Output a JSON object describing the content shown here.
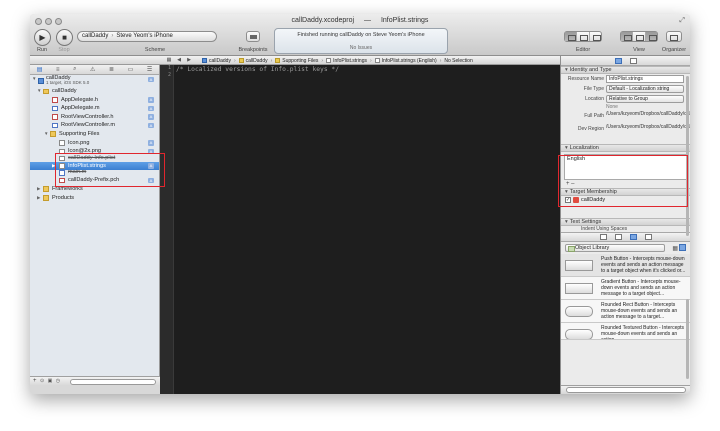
{
  "window": {
    "project": "callDaddy.xcodeproj",
    "separator": "—",
    "file": "InfoPlist.strings"
  },
  "toolbar": {
    "run_label": "Run",
    "stop_label": "Stop",
    "scheme_label": "Scheme",
    "breakpoints_label": "Breakpoints",
    "editor_label": "Editor",
    "view_label": "View",
    "organizer_label": "Organizer",
    "scheme_target": "callDaddy",
    "scheme_device": "Steve Yeom's iPhone",
    "activity_status": "Finished running callDaddy on Steve Yeom's iPhone",
    "activity_issues": "No Issues"
  },
  "jumpbar": {
    "crumbs": [
      "callDaddy",
      "callDaddy",
      "Supporting Files",
      "InfoPlist.strings",
      "InfoPlist.strings (English)",
      "No Selection"
    ]
  },
  "navigator": {
    "project_name": "callDaddy",
    "project_sub": "1 target, iOS SDK 5.0",
    "items": [
      {
        "label": "callDaddy"
      },
      {
        "label": "AppDelegate.h"
      },
      {
        "label": "AppDelegate.m"
      },
      {
        "label": "RootViewController.h"
      },
      {
        "label": "RootViewController.m"
      },
      {
        "label": "Supporting Files"
      },
      {
        "label": "Icon.png"
      },
      {
        "label": "Icon@2x.png"
      },
      {
        "label": "callDaddy-Info.plist"
      },
      {
        "label": "InfoPlist.strings"
      },
      {
        "label": "main.m"
      },
      {
        "label": "callDaddy-Prefix.pch"
      },
      {
        "label": "Frameworks"
      },
      {
        "label": "Products"
      }
    ],
    "badge": "A"
  },
  "editor": {
    "lines": [
      "1",
      "2"
    ],
    "code": "/* Localized versions of Info.plist keys */"
  },
  "inspector": {
    "identity_header": "Identity and Type",
    "resource_name_label": "Resource Name",
    "resource_name": "InfoPlist.strings",
    "file_type_label": "File Type",
    "file_type": "Default - Localization string",
    "location_label": "Location",
    "location": "Relative to Group",
    "location_none": "None",
    "full_path_label": "Full Path",
    "full_path": "/Users/kzyeom/Dropbox/callDaddy/callDaddy",
    "dev_region_label": "Dev Region",
    "dev_region": "/Users/kzyeom/Dropbox/callDaddy/callDaddy/en.lproj/InfoPlist.strings",
    "localization_header": "Localization",
    "localization_value": "English",
    "loc_controls": "+  –",
    "target_header": "Target Membership",
    "target_name": "callDaddy",
    "text_header": "Text Settings",
    "text_partial": "Indent Using   Spaces"
  },
  "library": {
    "selector": "Object Library",
    "items": [
      {
        "title": "Push Button - Intercepts mouse-down events and sends an action message to a target object when it's clicked or..."
      },
      {
        "title": "Gradient Button - Intercepts mouse-down events and sends an action message to a target object..."
      },
      {
        "title": "Rounded Rect Button - Intercepts mouse-down events and sends an action message to a target..."
      },
      {
        "title": "Rounded Textured Button - Intercepts mouse-down events and sends an action..."
      }
    ]
  }
}
